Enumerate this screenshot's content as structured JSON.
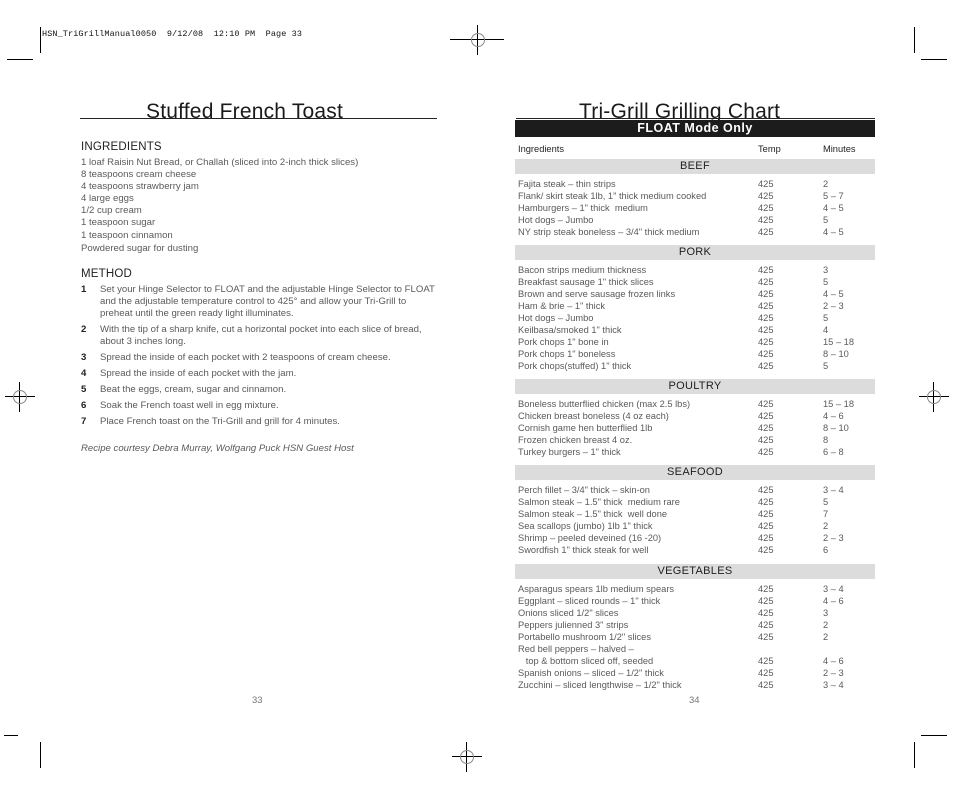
{
  "slug": "HSN_TriGrillManual0050  9/12/08  12:10 PM  Page 33",
  "left_page": {
    "title": "Stuffed French Toast",
    "ingredients_heading": "INGREDIENTS",
    "ingredients": [
      "1 loaf Raisin Nut Bread, or Challah (sliced into 2-inch thick slices)",
      "8 teaspoons cream cheese",
      "4 teaspoons strawberry jam",
      "4 large eggs",
      "1/2 cup cream",
      "1 teaspoon sugar",
      "1 teaspoon cinnamon",
      "Powdered sugar for dusting"
    ],
    "method_heading": "METHOD",
    "steps": [
      {
        "num": "1",
        "text": "Set your Hinge Selector to FLOAT and the adjustable Hinge Selector to FLOAT and the adjustable temperature control to 425° and allow your Tri-Grill to preheat until the green ready light illuminates."
      },
      {
        "num": "2",
        "text": "With the tip of a sharp knife, cut a horizontal pocket into each slice of bread, about 3 inches long."
      },
      {
        "num": "3",
        "text": "Spread the inside of each pocket with 2 teaspoons of cream cheese."
      },
      {
        "num": "4",
        "text": "Spread the inside of each pocket with the jam."
      },
      {
        "num": "5",
        "text": "Beat the eggs, cream, sugar and cinnamon."
      },
      {
        "num": "6",
        "text": "Soak the French toast well in egg mixture."
      },
      {
        "num": "7",
        "text": "Place French toast on the Tri-Grill and grill for 4 minutes."
      }
    ],
    "courtesy": "Recipe courtesy Debra Murray, Wolfgang Puck HSN Guest Host",
    "page_number": "33"
  },
  "right_page": {
    "title": "Tri-Grill Grilling Chart",
    "mode_banner": "FLOAT Mode Only",
    "columns": {
      "ingredients": "Ingredients",
      "temp": "Temp",
      "minutes": "Minutes"
    },
    "categories": [
      {
        "name": "BEEF",
        "rows": [
          {
            "ingredient": "Fajita steak – thin strips",
            "temp": "425",
            "minutes": "2"
          },
          {
            "ingredient": "Flank/ skirt steak 1lb, 1\" thick medium cooked",
            "temp": "425",
            "minutes": "5 – 7"
          },
          {
            "ingredient": "Hamburgers – 1\" thick  medium",
            "temp": "425",
            "minutes": "4 – 5"
          },
          {
            "ingredient": "Hot dogs – Jumbo",
            "temp": "425",
            "minutes": "5"
          },
          {
            "ingredient": "NY strip steak boneless – 3/4\" thick medium",
            "temp": "425",
            "minutes": "4 – 5"
          }
        ]
      },
      {
        "name": "PORK",
        "rows": [
          {
            "ingredient": "Bacon strips medium thickness",
            "temp": "425",
            "minutes": "3"
          },
          {
            "ingredient": "Breakfast sausage 1\" thick slices",
            "temp": "425",
            "minutes": "5"
          },
          {
            "ingredient": "Brown and serve sausage frozen links",
            "temp": "425",
            "minutes": "4 – 5"
          },
          {
            "ingredient": "Ham & brie – 1\" thick",
            "temp": "425",
            "minutes": "2 – 3"
          },
          {
            "ingredient": "Hot dogs – Jumbo",
            "temp": "425",
            "minutes": "5"
          },
          {
            "ingredient": "Keilbasa/smoked 1\" thick",
            "temp": "425",
            "minutes": "4"
          },
          {
            "ingredient": "Pork chops 1\" bone in",
            "temp": "425",
            "minutes": "15 – 18"
          },
          {
            "ingredient": "Pork chops 1\" boneless",
            "temp": "425",
            "minutes": "8 – 10"
          },
          {
            "ingredient": "Pork chops(stuffed) 1\" thick",
            "temp": "425",
            "minutes": "5"
          }
        ]
      },
      {
        "name": "POULTRY",
        "rows": [
          {
            "ingredient": "Boneless butterflied chicken (max 2.5 lbs)",
            "temp": "425",
            "minutes": "15 – 18"
          },
          {
            "ingredient": "Chicken breast boneless (4 oz each)",
            "temp": "425",
            "minutes": "4 – 6"
          },
          {
            "ingredient": "Cornish game hen butterflied 1lb",
            "temp": "425",
            "minutes": "8 – 10"
          },
          {
            "ingredient": "Frozen chicken breast 4 oz.",
            "temp": "425",
            "minutes": "8"
          },
          {
            "ingredient": "Turkey burgers – 1\" thick",
            "temp": "425",
            "minutes": "6 – 8"
          }
        ]
      },
      {
        "name": "SEAFOOD",
        "rows": [
          {
            "ingredient": "Perch fillet – 3/4\" thick – skin-on",
            "temp": "425",
            "minutes": "3 – 4"
          },
          {
            "ingredient": "Salmon steak – 1.5\" thick  medium rare",
            "temp": "425",
            "minutes": "5"
          },
          {
            "ingredient": "Salmon steak – 1.5\" thick  well done",
            "temp": "425",
            "minutes": "7"
          },
          {
            "ingredient": "Sea scallops (jumbo) 1lb 1\" thick",
            "temp": "425",
            "minutes": "2"
          },
          {
            "ingredient": "Shrimp – peeled deveined (16 -20)",
            "temp": "425",
            "minutes": "2 – 3"
          },
          {
            "ingredient": "Swordfish 1\" thick steak for well",
            "temp": "425",
            "minutes": "6"
          }
        ]
      },
      {
        "name": "VEGETABLES",
        "rows": [
          {
            "ingredient": "Asparagus spears 1lb medium spears",
            "temp": "425",
            "minutes": "3 – 4"
          },
          {
            "ingredient": "Eggplant – sliced rounds – 1\" thick",
            "temp": "425",
            "minutes": "4 – 6"
          },
          {
            "ingredient": "Onions sliced 1/2\" slices",
            "temp": "425",
            "minutes": "3"
          },
          {
            "ingredient": "Peppers julienned 3\" strips",
            "temp": "425",
            "minutes": "2"
          },
          {
            "ingredient": "Portabello mushroom 1/2\" slices",
            "temp": "425",
            "minutes": "2"
          },
          {
            "ingredient": "Red bell peppers – halved –",
            "temp": "",
            "minutes": ""
          },
          {
            "ingredient": "   top & bottom sliced off, seeded",
            "temp": "425",
            "minutes": "4 – 6"
          },
          {
            "ingredient": "Spanish onions – sliced – 1/2\" thick",
            "temp": "425",
            "minutes": "2 – 3"
          },
          {
            "ingredient": "Zucchini – sliced lengthwise – 1/2\" thick",
            "temp": "425",
            "minutes": "3 – 4"
          }
        ]
      }
    ],
    "page_number": "34"
  }
}
